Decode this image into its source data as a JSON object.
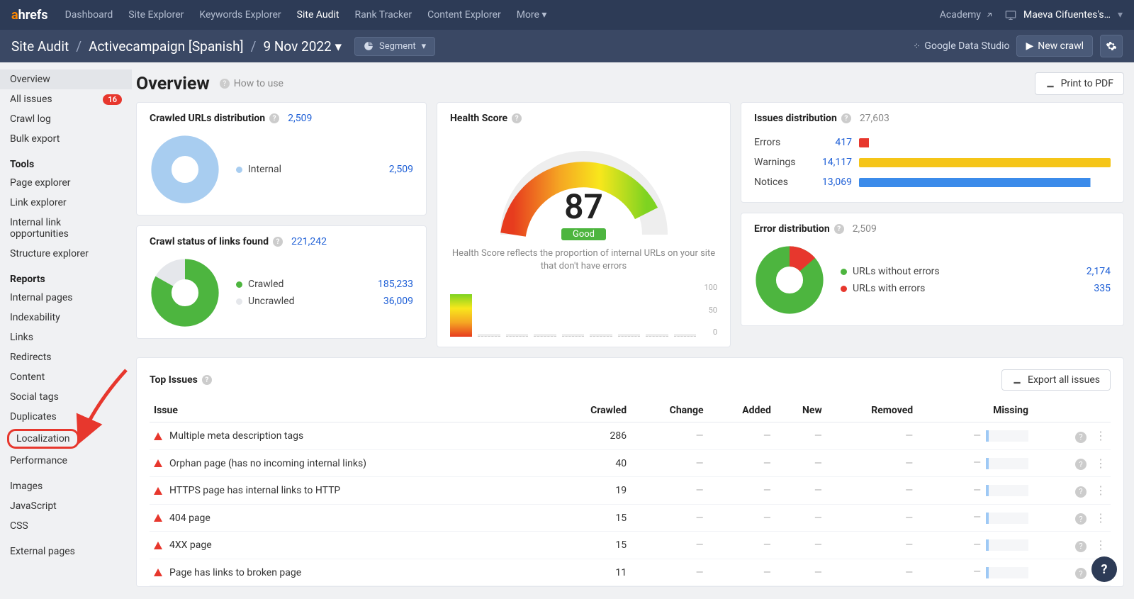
{
  "logo": {
    "a": "a",
    "rest": "hrefs"
  },
  "nav": [
    "Dashboard",
    "Site Explorer",
    "Keywords Explorer",
    "Site Audit",
    "Rank Tracker",
    "Content Explorer",
    "More"
  ],
  "nav_active": "Site Audit",
  "academy": "Academy",
  "user": "Maeva Cifuentes's…",
  "breadcrumb": {
    "a": "Site Audit",
    "b": "Activecampaign [Spanish]",
    "c": "9 Nov 2022"
  },
  "segment": "Segment",
  "gds": "Google Data Studio",
  "newcrawl": "New crawl",
  "sidebar": {
    "top": [
      {
        "label": "Overview",
        "active": true
      },
      {
        "label": "All issues",
        "badge": "16"
      },
      {
        "label": "Crawl log"
      },
      {
        "label": "Bulk export"
      }
    ],
    "tools_head": "Tools",
    "tools": [
      "Page explorer",
      "Link explorer",
      "Internal link opportunities",
      "Structure explorer"
    ],
    "reports_head": "Reports",
    "reports": [
      "Internal pages",
      "Indexability",
      "Links",
      "Redirects",
      "Content",
      "Social tags",
      "Duplicates",
      "Localization",
      "Performance"
    ],
    "extra": [
      "Images",
      "JavaScript",
      "CSS"
    ],
    "ext": "External pages"
  },
  "page": {
    "title": "Overview",
    "howto": "How to use",
    "print": "Print to PDF"
  },
  "chart_data": {
    "crawled_urls": {
      "type": "pie",
      "title": "Crawled URLs distribution",
      "total": "2,509",
      "series": [
        {
          "name": "Internal",
          "value": 2509,
          "color": "#a8cdf0"
        }
      ]
    },
    "crawl_status": {
      "type": "pie",
      "title": "Crawl status of links found",
      "total": "221,242",
      "series": [
        {
          "name": "Crawled",
          "value": 185233,
          "display": "185,233",
          "color": "#4db53f"
        },
        {
          "name": "Uncrawled",
          "value": 36009,
          "display": "36,009",
          "color": "#e5e7eb"
        }
      ]
    },
    "health": {
      "type": "gauge",
      "title": "Health Score",
      "value": 87,
      "status": "Good",
      "desc": "Health Score reflects the proportion of internal URLs on your site that don't have errors",
      "ylabels": [
        "100",
        "50",
        "0"
      ]
    },
    "issues_dist": {
      "type": "bar",
      "title": "Issues distribution",
      "total": "27,603",
      "rows": [
        {
          "label": "Errors",
          "value": "417",
          "color": "#e7372d",
          "w": 4
        },
        {
          "label": "Warnings",
          "value": "14,117",
          "color": "#f5c518",
          "w": 100
        },
        {
          "label": "Notices",
          "value": "13,069",
          "color": "#3b8bea",
          "w": 92
        }
      ]
    },
    "error_dist": {
      "type": "pie",
      "title": "Error distribution",
      "total": "2,509",
      "series": [
        {
          "name": "URLs without errors",
          "value": 2174,
          "display": "2,174",
          "color": "#4db53f"
        },
        {
          "name": "URLs with errors",
          "value": 335,
          "display": "335",
          "color": "#e7372d"
        }
      ]
    }
  },
  "topissues": {
    "title": "Top Issues",
    "export": "Export all issues",
    "cols": [
      "Issue",
      "Crawled",
      "Change",
      "Added",
      "New",
      "Removed",
      "Missing"
    ],
    "rows": [
      {
        "name": "Multiple meta description tags",
        "crawled": "286"
      },
      {
        "name": "Orphan page (has no incoming internal links)",
        "crawled": "40"
      },
      {
        "name": "HTTPS page has internal links to HTTP",
        "crawled": "19"
      },
      {
        "name": "404 page",
        "crawled": "15"
      },
      {
        "name": "4XX page",
        "crawled": "15"
      },
      {
        "name": "Page has links to broken page",
        "crawled": "11"
      }
    ]
  }
}
